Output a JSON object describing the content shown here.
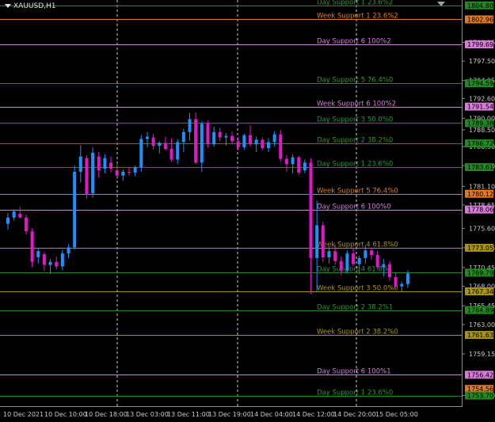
{
  "symbol": "XAUUSD,H1",
  "colors": {
    "background": "#000000",
    "bull": "#1e90ff",
    "bear": "#e018c8",
    "grid": "#cfcfcf",
    "axis_text": "#c8c8c8",
    "orange": "#e0781e",
    "violet": "#d87ad8",
    "green": "#1f8a1f",
    "olive": "#a8940c",
    "green_text": "#2a9a2a"
  },
  "chart_data": {
    "type": "candlestick",
    "ylim": [
      1752.2,
      1805.5
    ],
    "y_ticks": [
      "1799.96",
      "1797.50",
      "1794.95",
      "1792.60",
      "1790.00",
      "1788.50",
      "1786.30",
      "1783.80",
      "1781.10",
      "1778.65",
      "1775.60",
      "1773.05",
      "1770.45",
      "1768.00",
      "1765.45",
      "1763.00",
      "1759.15",
      "1753.70"
    ],
    "y_tick_values": [
      1799.96,
      1797.5,
      1794.95,
      1792.6,
      1790.0,
      1788.5,
      1786.3,
      1783.8,
      1781.1,
      1778.65,
      1775.6,
      1773.05,
      1770.45,
      1768.0,
      1765.45,
      1763.0,
      1759.15,
      1753.7
    ],
    "x_labels": [
      "10 Dec 2021",
      "10 Dec 10:00",
      "10 Dec 18:00",
      "13 Dec 03:00",
      "13 Dec 11:00",
      "13 Dec 19:00",
      "14 Dec 04:00",
      "14 Dec 12:00",
      "14 Dec 20:00",
      "15 Dec 05:00"
    ],
    "price_boxes": [
      {
        "value": "1804.80",
        "price": 1804.8,
        "color": "green"
      },
      {
        "value": "1802.96",
        "price": 1802.96,
        "color": "orange"
      },
      {
        "value": "1799.69",
        "price": 1799.69,
        "color": "violet"
      },
      {
        "value": "1794.59",
        "price": 1794.59,
        "color": "green"
      },
      {
        "value": "1791.54",
        "price": 1791.54,
        "color": "violet"
      },
      {
        "value": "1789.38",
        "price": 1789.38,
        "color": "green"
      },
      {
        "value": "1786.72",
        "price": 1786.72,
        "color": "green"
      },
      {
        "value": "1783.61",
        "price": 1783.61,
        "color": "green"
      },
      {
        "value": "1780.12",
        "price": 1780.12,
        "color": "orange"
      },
      {
        "value": "1778.06",
        "price": 1778.06,
        "color": "violet"
      },
      {
        "value": "1773.05",
        "price": 1773.05,
        "color": "olive"
      },
      {
        "value": "1769.79",
        "price": 1769.79,
        "color": "green"
      },
      {
        "value": "1767.34",
        "price": 1767.34,
        "color": "olive"
      },
      {
        "value": "1764.89",
        "price": 1764.89,
        "color": "green"
      },
      {
        "value": "1761.63",
        "price": 1761.63,
        "color": "olive"
      },
      {
        "value": "1756.42",
        "price": 1756.42,
        "color": "violet"
      },
      {
        "value": "1754.56",
        "price": 1754.56,
        "color": "orange"
      },
      {
        "value": "1753.70",
        "price": 1753.7,
        "color": "green"
      }
    ],
    "levels": [
      {
        "label": "Day Support 1 23.6%2",
        "price": 1804.8,
        "color": "green"
      },
      {
        "label": "Week Support 1 23.6%2",
        "price": 1802.96,
        "color": "orange"
      },
      {
        "label": "Day Support 6 100%2",
        "price": 1799.69,
        "color": "violet"
      },
      {
        "label": "Day Support 5 76.4%0",
        "price": 1794.59,
        "color": "green"
      },
      {
        "label": "Week Support 6 100%2",
        "price": 1791.54,
        "color": "violet"
      },
      {
        "label": "Day Support 3 50.0%0",
        "price": 1789.38,
        "color": "green"
      },
      {
        "label": "Day Support 2 38.2%0",
        "price": 1786.72,
        "color": "green"
      },
      {
        "label": "Day Support 1 23.6%0",
        "price": 1783.61,
        "color": "green"
      },
      {
        "label": "Week Support 5 76.4%0",
        "price": 1780.12,
        "color": "orange"
      },
      {
        "label": "Day Support 6 100%0",
        "price": 1778.06,
        "color": "violet"
      },
      {
        "label": "Week Support 4 61.8%0",
        "price": 1773.05,
        "color": "olive"
      },
      {
        "label": "Day Support 4 61.8%1",
        "price": 1769.79,
        "color": "green"
      },
      {
        "label": "Week Support 3 50.0%0",
        "price": 1767.34,
        "color": "olive"
      },
      {
        "label": "Day Support 2 38.2%1",
        "price": 1764.89,
        "color": "green"
      },
      {
        "label": "Week Support 2 38.2%0",
        "price": 1761.63,
        "color": "olive"
      },
      {
        "label": "Day Support 6 100%1",
        "price": 1756.42,
        "color": "violet"
      },
      {
        "label": "Day Support 1 23.6%0",
        "price": 1753.7,
        "color": "green"
      }
    ],
    "candles": [
      [
        1776.2,
        1777.6,
        1775.4,
        1777.0
      ],
      [
        1777.0,
        1778.1,
        1776.6,
        1777.8
      ],
      [
        1777.5,
        1778.4,
        1776.9,
        1777.0
      ],
      [
        1777.0,
        1777.4,
        1774.8,
        1775.2
      ],
      [
        1775.2,
        1775.6,
        1770.5,
        1771.2
      ],
      [
        1771.8,
        1773.0,
        1771.0,
        1772.6
      ],
      [
        1772.2,
        1772.5,
        1770.0,
        1770.8
      ],
      [
        1770.8,
        1771.6,
        1769.6,
        1771.2
      ],
      [
        1771.2,
        1771.9,
        1770.2,
        1770.6
      ],
      [
        1770.6,
        1772.8,
        1770.1,
        1772.3
      ],
      [
        1772.3,
        1773.5,
        1771.7,
        1773.1
      ],
      [
        1773.1,
        1783.8,
        1772.8,
        1783.0
      ],
      [
        1783.0,
        1786.5,
        1781.6,
        1785.0
      ],
      [
        1784.8,
        1785.2,
        1779.5,
        1780.0
      ],
      [
        1780.2,
        1786.2,
        1779.6,
        1785.5
      ],
      [
        1785.0,
        1785.6,
        1782.2,
        1783.2
      ],
      [
        1783.4,
        1785.3,
        1782.8,
        1784.8
      ],
      [
        1784.2,
        1785.0,
        1782.9,
        1783.4
      ],
      [
        1783.2,
        1784.1,
        1782.0,
        1782.5
      ],
      [
        1782.5,
        1783.3,
        1781.8,
        1783.0
      ],
      [
        1783.0,
        1783.6,
        1782.5,
        1782.9
      ],
      [
        1782.9,
        1783.8,
        1782.4,
        1783.6
      ],
      [
        1783.6,
        1787.8,
        1783.0,
        1787.3
      ],
      [
        1787.3,
        1788.2,
        1786.2,
        1787.6
      ],
      [
        1787.5,
        1788.0,
        1785.9,
        1786.4
      ],
      [
        1786.4,
        1787.0,
        1785.4,
        1786.8
      ],
      [
        1786.8,
        1787.6,
        1785.8,
        1786.0
      ],
      [
        1786.0,
        1787.4,
        1784.3,
        1784.6
      ],
      [
        1784.6,
        1787.3,
        1784.0,
        1786.9
      ],
      [
        1786.9,
        1788.6,
        1785.6,
        1788.2
      ],
      [
        1788.2,
        1790.7,
        1787.1,
        1789.9
      ],
      [
        1789.9,
        1790.8,
        1784.0,
        1784.2
      ],
      [
        1784.2,
        1789.6,
        1783.0,
        1789.3
      ],
      [
        1789.3,
        1789.7,
        1786.2,
        1786.6
      ],
      [
        1786.6,
        1788.9,
        1786.3,
        1788.2
      ],
      [
        1788.2,
        1788.8,
        1787.0,
        1787.5
      ],
      [
        1787.5,
        1788.1,
        1786.4,
        1787.7
      ],
      [
        1787.7,
        1788.3,
        1786.6,
        1787.0
      ],
      [
        1787.0,
        1787.6,
        1785.8,
        1786.2
      ],
      [
        1786.2,
        1788.0,
        1785.9,
        1787.8
      ],
      [
        1787.8,
        1789.1,
        1786.3,
        1786.6
      ],
      [
        1786.6,
        1787.6,
        1785.6,
        1787.2
      ],
      [
        1787.2,
        1787.5,
        1785.8,
        1786.1
      ],
      [
        1786.1,
        1787.4,
        1785.6,
        1786.9
      ],
      [
        1786.9,
        1788.3,
        1786.3,
        1787.9
      ],
      [
        1787.9,
        1788.5,
        1784.3,
        1784.7
      ],
      [
        1784.7,
        1785.2,
        1783.0,
        1784.0
      ],
      [
        1784.0,
        1785.3,
        1782.8,
        1784.9
      ],
      [
        1784.9,
        1785.1,
        1782.6,
        1782.9
      ],
      [
        1783.2,
        1784.6,
        1782.8,
        1784.2
      ],
      [
        1784.2,
        1784.8,
        1767.0,
        1771.7
      ],
      [
        1771.7,
        1779.2,
        1767.4,
        1776.0
      ],
      [
        1776.0,
        1776.5,
        1771.2,
        1771.8
      ],
      [
        1771.8,
        1773.1,
        1771.0,
        1772.6
      ],
      [
        1772.6,
        1773.5,
        1770.8,
        1771.3
      ],
      [
        1771.3,
        1771.9,
        1769.5,
        1770.1
      ],
      [
        1770.1,
        1772.7,
        1769.7,
        1772.3
      ],
      [
        1772.3,
        1773.0,
        1770.6,
        1770.9
      ],
      [
        1770.9,
        1772.0,
        1769.6,
        1771.7
      ],
      [
        1771.7,
        1773.4,
        1771.0,
        1772.7
      ],
      [
        1772.7,
        1773.1,
        1771.5,
        1772.1
      ],
      [
        1772.1,
        1772.6,
        1770.2,
        1770.5
      ],
      [
        1770.5,
        1771.6,
        1769.3,
        1770.9
      ],
      [
        1770.9,
        1771.3,
        1768.7,
        1769.2
      ],
      [
        1769.2,
        1769.8,
        1767.8,
        1768.0
      ],
      [
        1768.0,
        1768.6,
        1767.3,
        1768.3
      ],
      [
        1768.3,
        1770.1,
        1767.8,
        1769.7
      ]
    ]
  }
}
